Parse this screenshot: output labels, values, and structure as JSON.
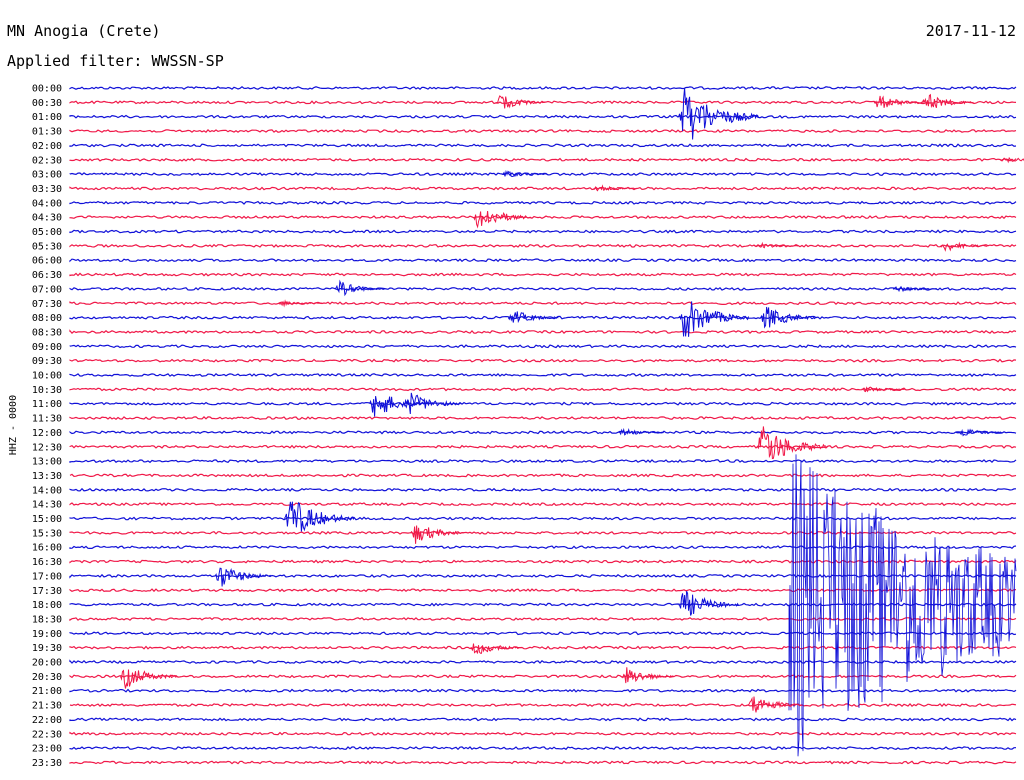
{
  "header": {
    "station": "MN Anogia (Crete)",
    "date": "2017-11-12",
    "filter": "Applied filter: WWSSN-SP"
  },
  "axis": {
    "channel_label": "HHZ - 0000"
  },
  "colors": {
    "trace_a": "#1010d8",
    "trace_b": "#f01848",
    "background": "#ffffff",
    "text": "#000000"
  },
  "chart_data": {
    "type": "line",
    "title": "MN Anogia (Crete)",
    "subtitle": "Applied filter: WWSSN-SP",
    "ylabel": "HHZ - 0000",
    "grid": false,
    "categories": [
      "00:00",
      "00:30",
      "01:00",
      "01:30",
      "02:00",
      "02:30",
      "03:00",
      "03:30",
      "04:00",
      "04:30",
      "05:00",
      "05:30",
      "06:00",
      "06:30",
      "07:00",
      "07:30",
      "08:00",
      "08:30",
      "09:00",
      "09:30",
      "10:00",
      "10:30",
      "11:00",
      "11:30",
      "12:00",
      "12:30",
      "13:00",
      "13:30",
      "14:00",
      "14:30",
      "15:00",
      "15:30",
      "16:00",
      "16:30",
      "17:00",
      "17:30",
      "18:00",
      "18:30",
      "19:00",
      "19:30",
      "20:00",
      "20:30",
      "21:00",
      "21:30",
      "22:00",
      "22:30",
      "23:00",
      "23:30"
    ],
    "trace_window_minutes": 30,
    "alternating_colors": [
      "#1010d8",
      "#f01848"
    ],
    "events": [
      {
        "row": "00:30",
        "minute": 13.5,
        "amplitude": 1.0
      },
      {
        "row": "00:30",
        "minute": 25.5,
        "amplitude": 1.0
      },
      {
        "row": "00:30",
        "minute": 27.0,
        "amplitude": 1.2
      },
      {
        "row": "01:00",
        "minute": 19.3,
        "amplitude": 4.0
      },
      {
        "row": "02:30",
        "minute": 29.5,
        "amplitude": 0.4
      },
      {
        "row": "03:00",
        "minute": 13.7,
        "amplitude": 0.5
      },
      {
        "row": "03:30",
        "minute": 16.6,
        "amplitude": 0.4
      },
      {
        "row": "04:30",
        "minute": 12.8,
        "amplitude": 1.8
      },
      {
        "row": "05:30",
        "minute": 21.7,
        "amplitude": 0.4
      },
      {
        "row": "05:30",
        "minute": 27.6,
        "amplitude": 0.7
      },
      {
        "row": "07:00",
        "minute": 8.4,
        "amplitude": 1.0
      },
      {
        "row": "07:00",
        "minute": 26.1,
        "amplitude": 0.4
      },
      {
        "row": "07:30",
        "minute": 6.6,
        "amplitude": 0.4
      },
      {
        "row": "08:00",
        "minute": 13.9,
        "amplitude": 1.0
      },
      {
        "row": "08:00",
        "minute": 19.3,
        "amplitude": 3.0
      },
      {
        "row": "08:00",
        "minute": 21.9,
        "amplitude": 1.6
      },
      {
        "row": "10:30",
        "minute": 25.1,
        "amplitude": 0.4
      },
      {
        "row": "11:00",
        "minute": 9.5,
        "amplitude": 2.0
      },
      {
        "row": "11:00",
        "minute": 10.6,
        "amplitude": 1.6
      },
      {
        "row": "12:00",
        "minute": 17.4,
        "amplitude": 0.5
      },
      {
        "row": "12:00",
        "minute": 28.1,
        "amplitude": 0.6
      },
      {
        "row": "12:30",
        "minute": 21.8,
        "amplitude": 3.0
      },
      {
        "row": "15:00",
        "minute": 6.8,
        "amplitude": 3.0
      },
      {
        "row": "15:30",
        "minute": 10.8,
        "amplitude": 1.4
      },
      {
        "row": "17:00",
        "minute": 4.6,
        "amplitude": 1.6
      },
      {
        "row": "18:00",
        "minute": 19.3,
        "amplitude": 2.0
      },
      {
        "row": "18:00",
        "minute": 22.8,
        "amplitude": 20.0
      },
      {
        "row": "19:30",
        "minute": 12.7,
        "amplitude": 1.0
      },
      {
        "row": "20:30",
        "minute": 1.6,
        "amplitude": 1.6
      },
      {
        "row": "20:30",
        "minute": 17.5,
        "amplitude": 1.2
      },
      {
        "row": "21:30",
        "minute": 21.5,
        "amplitude": 1.4
      }
    ]
  }
}
